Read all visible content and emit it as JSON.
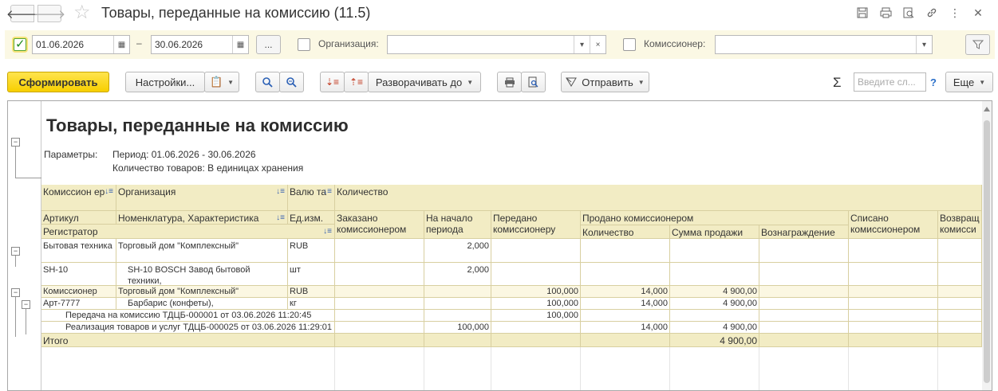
{
  "window": {
    "title": "Товары, переданные на комиссию (11.5)",
    "back_icon": "arrow-left-icon",
    "forward_icon": "arrow-right-icon"
  },
  "filters": {
    "period_from": "01.06.2026",
    "period_separator": "–",
    "period_to": "30.06.2026",
    "more_label": "...",
    "org_label": "Организация:",
    "org_value": "",
    "commissioner_label": "Комиссионер:",
    "commissioner_value": "",
    "clear_label": "×"
  },
  "commands": {
    "generate": "Сформировать",
    "settings": "Настройки...",
    "expand_to": "Разворачивать до",
    "send": "Отправить",
    "search_placeholder": "Введите сл...",
    "help": "?",
    "more": "Еще",
    "sigma": "Σ"
  },
  "report": {
    "title": "Товары, переданные на комиссию",
    "params_label": "Параметры:",
    "param_period": "Период: 01.06.2026 - 30.06.2026",
    "param_qty": "Количество товаров: В единицах хранения",
    "headers": {
      "commissioner": "Комиссион ер",
      "organization": "Организация",
      "currency": "Валю та",
      "quantity": "Количество",
      "article": "Артикул",
      "nomenclature": "Номенклатура, Характеристика",
      "unit": "Ед.изм.",
      "ordered": "Заказано комиссионером",
      "start_period": "На начало периода",
      "transferred": "Передано комиссионеру",
      "sold": "Продано комиссионером",
      "sold_qty": "Количество",
      "sold_sum": "Сумма продажи",
      "reward": "Вознаграждение",
      "written_off": "Списано комиссионером",
      "returned": "Возвращ комисси",
      "registrar": "Регистратор"
    },
    "rows": {
      "r1": {
        "c1": "Бытовая техника",
        "c2": "Торговый дом \"Комплексный\"",
        "c3": "RUB",
        "start": "2,000"
      },
      "r2": {
        "c1": "SH-10",
        "c2": "SH-10 BOSCH Завод бытовой техники,",
        "c3": "шт",
        "start": "2,000"
      },
      "r3": {
        "c1": "Комиссионер",
        "c2": "Торговый дом \"Комплексный\"",
        "c3": "RUB",
        "transferred": "100,000",
        "sold_qty": "14,000",
        "sold_sum": "4 900,00"
      },
      "r4": {
        "c1": "Арт-7777",
        "c2": "Барбарис (конфеты),",
        "c3": "кг",
        "transferred": "100,000",
        "sold_qty": "14,000",
        "sold_sum": "4 900,00"
      },
      "r5": {
        "doc": "Передача на комиссию ТДЦБ-000001 от 03.06.2026 11:20:45",
        "transferred": "100,000"
      },
      "r6": {
        "doc": "Реализация товаров и услуг ТДЦБ-000025 от 03.06.2026 11:29:01",
        "start": "100,000",
        "sold_qty": "14,000",
        "sold_sum": "4 900,00"
      },
      "total": {
        "label": "Итого",
        "sold_sum": "4 900,00"
      }
    }
  }
}
